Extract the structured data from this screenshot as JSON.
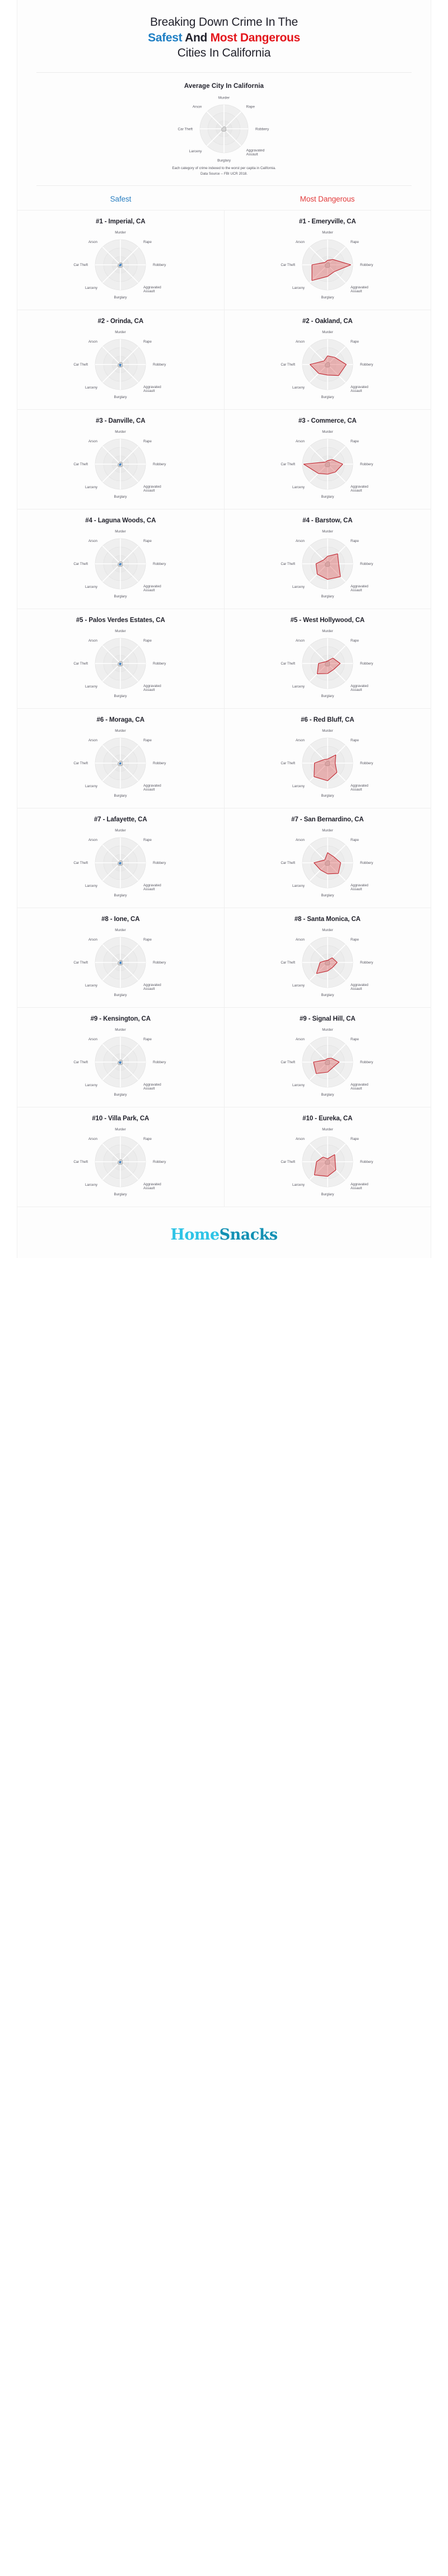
{
  "header": {
    "line1": "Breaking Down Crime In The",
    "line2_safest": "Safest",
    "line2_and": " And ",
    "line2_dangerous": "Most Dangerous",
    "line3": "Cities In California"
  },
  "average": {
    "title": "Average City In California"
  },
  "footnote": {
    "line1": "Each category of crime indexed to the worst per capita in California.",
    "line2": "Data Source -- FBI UCR 2018."
  },
  "columns": {
    "safest_label": "Safest",
    "dangerous_label": "Most Dangerous"
  },
  "colors": {
    "safe_accent": "#2a7fc1",
    "danger_accent": "#e23b3b",
    "title_blue": "#1f7fc4",
    "title_red": "#e4161c",
    "grid": "#e4e4e4",
    "avg_fill": "#b9b9b9",
    "logo_home": "#2ec4e6",
    "logo_snacks": "#1391b4"
  },
  "footer": {
    "logo_part1": "Home",
    "logo_part2": "Snacks"
  },
  "chart_data": {
    "type": "radar",
    "axes": [
      "Murder",
      "Rape",
      "Robbery",
      "Aggravated Assault",
      "Burglary",
      "Larceny",
      "Car Theft",
      "Arson"
    ],
    "scale": "Each category indexed to the worst per capita city in California (0 to 1)",
    "rings": 3,
    "grid": true,
    "legend": "none",
    "average_series": {
      "name": "Average City In California",
      "values": [
        0.09,
        0.1,
        0.08,
        0.12,
        0.11,
        0.13,
        0.1,
        0.07
      ]
    },
    "safest": [
      {
        "rank": "#1",
        "name": "#1 - Imperial, CA",
        "values": [
          0.02,
          0.05,
          0.02,
          0.04,
          0.04,
          0.06,
          0.03,
          0.01
        ]
      },
      {
        "rank": "#2",
        "name": "#2 - Orinda, CA",
        "values": [
          0.01,
          0.02,
          0.02,
          0.02,
          0.07,
          0.05,
          0.04,
          0.01
        ]
      },
      {
        "rank": "#3",
        "name": "#3 - Danville, CA",
        "values": [
          0.01,
          0.03,
          0.02,
          0.02,
          0.05,
          0.06,
          0.03,
          0.01
        ]
      },
      {
        "rank": "#4",
        "name": "#4 - Laguna Woods, CA",
        "values": [
          0.01,
          0.02,
          0.03,
          0.03,
          0.05,
          0.06,
          0.03,
          0.01
        ]
      },
      {
        "rank": "#5",
        "name": "#5 - Palos Verdes Estates, CA",
        "values": [
          0.01,
          0.02,
          0.02,
          0.02,
          0.06,
          0.05,
          0.04,
          0.01
        ]
      },
      {
        "rank": "#6",
        "name": "#6 - Moraga, CA",
        "values": [
          0.01,
          0.02,
          0.02,
          0.02,
          0.04,
          0.05,
          0.02,
          0.01
        ]
      },
      {
        "rank": "#7",
        "name": "#7 - Lafayette, CA",
        "values": [
          0.01,
          0.02,
          0.02,
          0.03,
          0.05,
          0.06,
          0.04,
          0.01
        ]
      },
      {
        "rank": "#8",
        "name": "#8 - Ione, CA",
        "values": [
          0.01,
          0.04,
          0.01,
          0.05,
          0.05,
          0.04,
          0.02,
          0.01
        ]
      },
      {
        "rank": "#9",
        "name": "#9 - Kensington, CA",
        "values": [
          0.01,
          0.02,
          0.03,
          0.02,
          0.06,
          0.05,
          0.05,
          0.01
        ]
      },
      {
        "rank": "#10",
        "name": "#10 - Villa Park, CA",
        "values": [
          0.01,
          0.02,
          0.02,
          0.02,
          0.05,
          0.05,
          0.04,
          0.01
        ]
      }
    ],
    "most_dangerous": [
      {
        "rank": "#1",
        "name": "#1 - Emeryville, CA",
        "values": [
          0.18,
          0.3,
          0.92,
          0.38,
          0.46,
          0.88,
          0.62,
          0.14
        ]
      },
      {
        "rank": "#2",
        "name": "#2 - Oakland, CA",
        "values": [
          0.34,
          0.4,
          0.74,
          0.62,
          0.42,
          0.5,
          0.7,
          0.2
        ]
      },
      {
        "rank": "#3",
        "name": "#3 - Commerce, CA",
        "values": [
          0.14,
          0.26,
          0.6,
          0.44,
          0.4,
          0.52,
          0.95,
          0.12
        ]
      },
      {
        "rank": "#4",
        "name": "#4 - Barstow, CA",
        "values": [
          0.3,
          0.56,
          0.44,
          0.72,
          0.62,
          0.58,
          0.46,
          0.22
        ]
      },
      {
        "rank": "#5",
        "name": "#5 - West Hollywood, CA",
        "values": [
          0.1,
          0.3,
          0.5,
          0.34,
          0.4,
          0.58,
          0.36,
          0.1
        ]
      },
      {
        "rank": "#6",
        "name": "#6 - Red Bluff, CA",
        "values": [
          0.16,
          0.46,
          0.3,
          0.52,
          0.7,
          0.76,
          0.52,
          0.2
        ]
      },
      {
        "rank": "#7",
        "name": "#7 - San Bernardino, CA",
        "values": [
          0.4,
          0.34,
          0.52,
          0.6,
          0.44,
          0.4,
          0.54,
          0.16
        ]
      },
      {
        "rank": "#8",
        "name": "#8 - Santa Monica, CA",
        "values": [
          0.08,
          0.26,
          0.38,
          0.28,
          0.34,
          0.62,
          0.3,
          0.1
        ]
      },
      {
        "rank": "#9",
        "name": "#9 - Signal Hill, CA",
        "values": [
          0.14,
          0.22,
          0.46,
          0.3,
          0.4,
          0.64,
          0.56,
          0.12
        ]
      },
      {
        "rank": "#10",
        "name": "#10 - Eureka, CA",
        "values": [
          0.12,
          0.4,
          0.3,
          0.46,
          0.58,
          0.74,
          0.44,
          0.26
        ]
      }
    ]
  }
}
